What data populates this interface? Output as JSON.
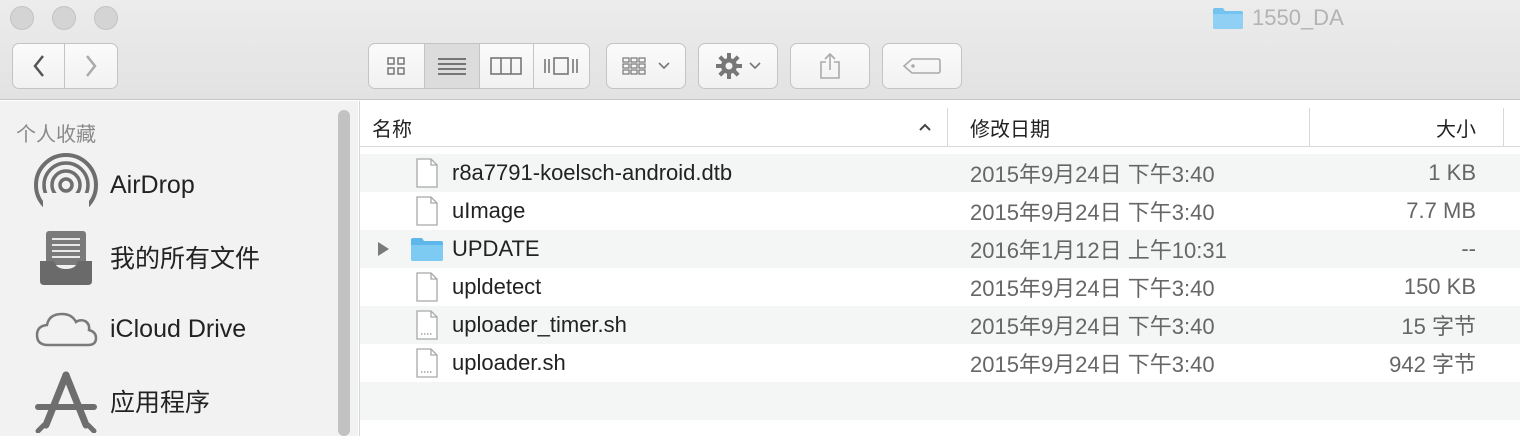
{
  "window": {
    "title": "1550_DA"
  },
  "toolbar": {
    "back_icon": "chevron-left-icon",
    "forward_icon": "chevron-right-icon",
    "view_icons": [
      "icon-view-icon",
      "list-view-icon",
      "column-view-icon",
      "cover-flow-icon"
    ],
    "active_view": "list",
    "arrange_icon": "arrange-grid-icon",
    "action_icon": "gear-icon",
    "share_icon": "share-icon",
    "tag_icon": "tag-icon"
  },
  "sidebar": {
    "header": "个人收藏",
    "items": [
      {
        "label": "AirDrop",
        "icon": "airdrop-icon"
      },
      {
        "label": "我的所有文件",
        "icon": "all-files-icon"
      },
      {
        "label": "iCloud Drive",
        "icon": "cloud-icon"
      },
      {
        "label": "应用程序",
        "icon": "applications-icon"
      }
    ]
  },
  "columns": {
    "name": "名称",
    "date": "修改日期",
    "size": "大小"
  },
  "files": [
    {
      "name": "r8a7791-koelsch-android.dtb",
      "date": "2015年9月24日 下午3:40",
      "size": "1 KB",
      "kind": "document"
    },
    {
      "name": "uImage",
      "date": "2015年9月24日 下午3:40",
      "size": "7.7 MB",
      "kind": "document"
    },
    {
      "name": "UPDATE",
      "date": "2016年1月12日 上午10:31",
      "size": "--",
      "kind": "folder"
    },
    {
      "name": "upldetect",
      "date": "2015年9月24日 下午3:40",
      "size": "150 KB",
      "kind": "document"
    },
    {
      "name": "uploader_timer.sh",
      "date": "2015年9月24日 下午3:40",
      "size": "15 字节",
      "kind": "script"
    },
    {
      "name": "uploader.sh",
      "date": "2015年9月24日 下午3:40",
      "size": "942 字节",
      "kind": "script"
    }
  ],
  "colors": {
    "folder": "#6cc0ee",
    "selection_row": "#f4f5f5",
    "sidebar_bg": "#f2f2f2"
  }
}
